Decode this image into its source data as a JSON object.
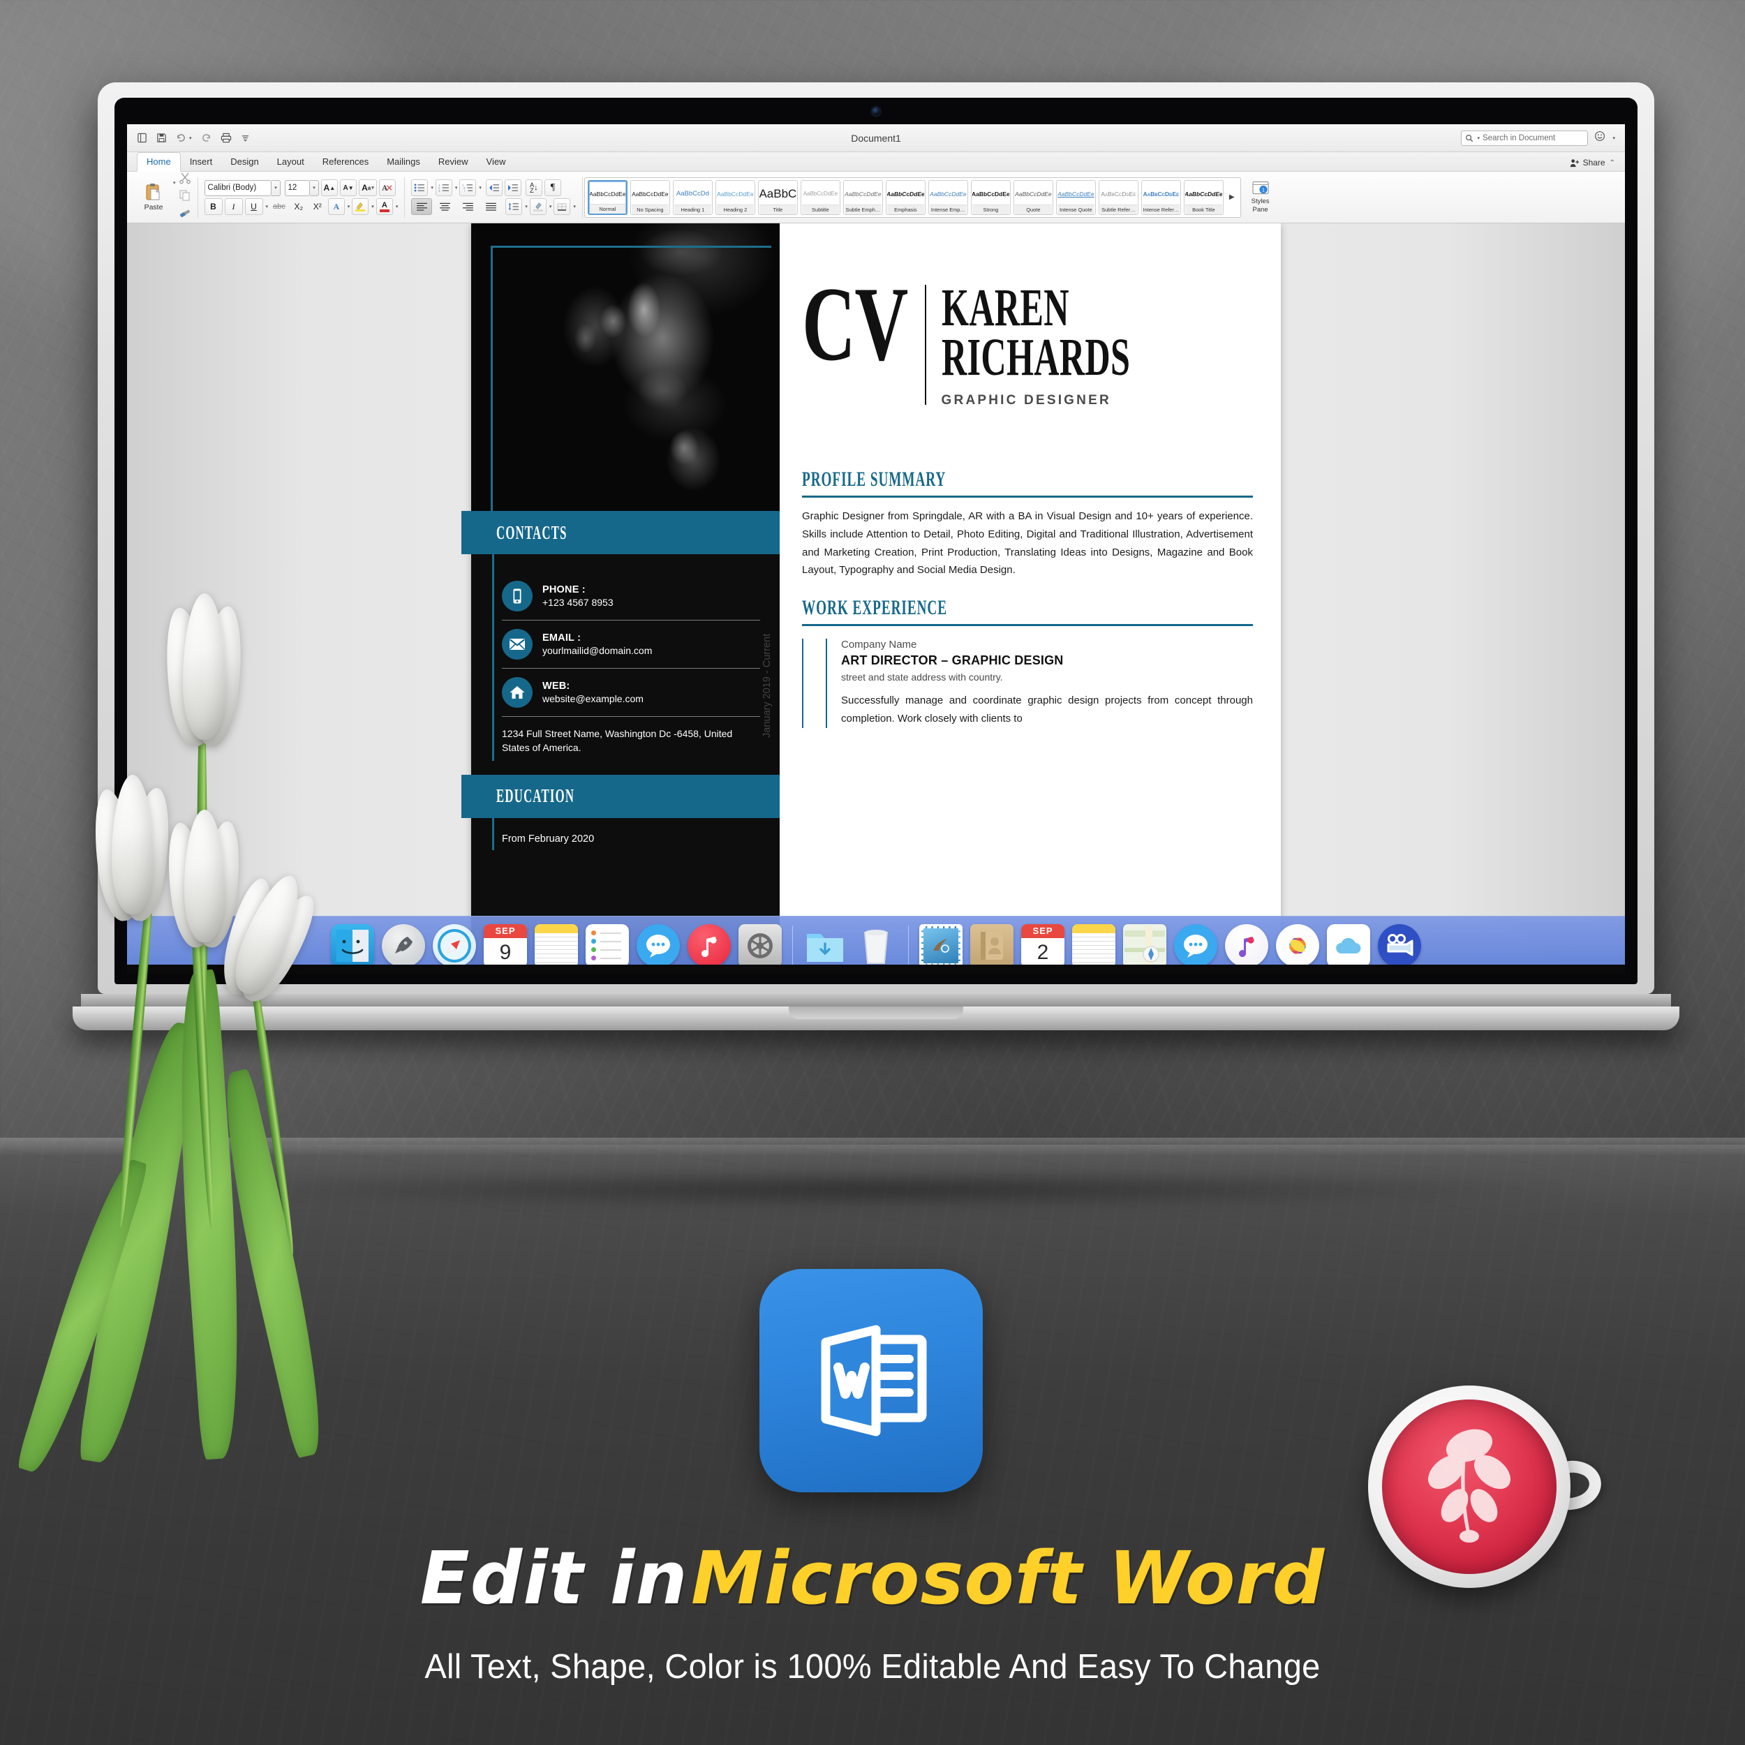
{
  "app": {
    "window_title": "Document1",
    "search_placeholder": "Search in Document",
    "share_label": "Share",
    "quick_access": [
      "new-document-icon",
      "save-icon",
      "undo-icon",
      "redo-icon",
      "print-icon",
      "customize-toolbar-icon"
    ],
    "smiley_icon": "smiley-feedback-icon",
    "collapse_icon": "collapse-ribbon-icon"
  },
  "tabs": [
    {
      "label": "Home",
      "active": true
    },
    {
      "label": "Insert",
      "active": false
    },
    {
      "label": "Design",
      "active": false
    },
    {
      "label": "Layout",
      "active": false
    },
    {
      "label": "References",
      "active": false
    },
    {
      "label": "Mailings",
      "active": false
    },
    {
      "label": "Review",
      "active": false
    },
    {
      "label": "View",
      "active": false
    }
  ],
  "ribbon": {
    "paste_label": "Paste",
    "font_name": "Calibri (Body)",
    "font_size": "12",
    "grow_font": "A▲",
    "shrink_font": "A▼",
    "change_case": "Aa",
    "clear_formatting": "clear-formatting-icon",
    "bold": "B",
    "italic": "I",
    "underline": "U",
    "strikethrough": "abc",
    "subscript": "X₂",
    "superscript": "X²",
    "text_effects": "A",
    "highlight": "highlight-icon",
    "font_color": "A",
    "styles_pane_label": "Styles\nPane",
    "styles_pane_line1": "Styles",
    "styles_pane_line2": "Pane"
  },
  "styles_gallery": [
    {
      "sample": "AaBbCcDdEe",
      "name": "Normal",
      "selected": true
    },
    {
      "sample": "AaBbCcDdEe",
      "name": "No Spacing",
      "selected": false
    },
    {
      "sample": "AaBbCcDd",
      "name": "Heading 1",
      "selected": false
    },
    {
      "sample": "AaBbCcDdEe",
      "name": "Heading 2",
      "selected": false
    },
    {
      "sample": "AaBbC",
      "name": "Title",
      "selected": false
    },
    {
      "sample": "AaBbCcDdEe",
      "name": "Subtitle",
      "selected": false
    },
    {
      "sample": "AaBbCcDdEe",
      "name": "Subtle Emph…",
      "selected": false
    },
    {
      "sample": "AaBbCcDdEe",
      "name": "Emphasis",
      "selected": false
    },
    {
      "sample": "AaBbCcDdEe",
      "name": "Intense Emp…",
      "selected": false
    },
    {
      "sample": "AaBbCcDdEe",
      "name": "Strong",
      "selected": false
    },
    {
      "sample": "AaBbCcDdEe",
      "name": "Quote",
      "selected": false
    },
    {
      "sample": "AaBbCcDdEe",
      "name": "Intense Quote",
      "selected": false
    },
    {
      "sample": "AaBbCcDdEe",
      "name": "Subtle Refer…",
      "selected": false
    },
    {
      "sample": "AaBbCcDdEe",
      "name": "Intense Refer…",
      "selected": false
    },
    {
      "sample": "AaBbCcDdEe",
      "name": "Book Title",
      "selected": false
    }
  ],
  "document": {
    "header": {
      "cv_word": "CV",
      "name_line1": "KAREN",
      "name_line2": "RICHARDS",
      "role": "GRAPHIC DESIGNER"
    },
    "sidebar": {
      "contacts_heading": "CONTACTS",
      "contacts": [
        {
          "icon": "phone-icon",
          "label": "PHONE :",
          "value": "+123 4567 8953"
        },
        {
          "icon": "email-icon",
          "label": "EMAIL :",
          "value": "yourlmailid@domain.com"
        },
        {
          "icon": "home-icon",
          "label": "WEB:",
          "value": "website@example.com"
        }
      ],
      "address": "1234 Full Street Name, Washington Dc -6458, United States of America.",
      "education_heading": "EDUCATION",
      "education_date": "From February 2020"
    },
    "profile": {
      "heading": "PROFILE SUMMARY",
      "text": "Graphic Designer from Springdale, AR with a BA in Visual Design and 10+ years of experience. Skills include Attention to Detail, Photo Editing, Digital and Traditional Illustration, Advertisement and Marketing Creation, Print Production, Translating Ideas into Designs, Magazine and Book Layout, Typography and Social Media Design."
    },
    "work": {
      "heading": "WORK EXPERIENCE",
      "entries": [
        {
          "date": "January 2019 - Current",
          "company": "Company Name",
          "title": "ART DIRECTOR – GRAPHIC DESIGN",
          "address": "street and state address with country.",
          "description": "Successfully manage and coordinate graphic design projects from concept through completion. Work closely with clients to"
        }
      ]
    }
  },
  "dock": [
    {
      "name": "finder-icon",
      "running": true
    },
    {
      "name": "launchpad-icon",
      "running": false
    },
    {
      "name": "safari-icon",
      "running": false
    },
    {
      "name": "calendar-icon",
      "running": false,
      "month": "SEP",
      "day": "9"
    },
    {
      "name": "notes-icon",
      "running": false
    },
    {
      "name": "reminders-icon",
      "running": false
    },
    {
      "name": "messages-icon",
      "running": false
    },
    {
      "name": "itunes-icon",
      "running": false
    },
    {
      "name": "system-preferences-icon",
      "running": false
    },
    {
      "name": "separator",
      "running": false
    },
    {
      "name": "downloads-folder-icon",
      "running": false
    },
    {
      "name": "trash-icon",
      "running": false
    },
    {
      "name": "separator",
      "running": false
    },
    {
      "name": "mail-icon",
      "running": true
    },
    {
      "name": "contacts-icon",
      "running": false
    },
    {
      "name": "calendar-icon-2",
      "running": false,
      "month": "SEP",
      "day": "2"
    },
    {
      "name": "notes-icon-2",
      "running": false
    },
    {
      "name": "maps-icon",
      "running": false
    },
    {
      "name": "messages-icon-2",
      "running": false
    },
    {
      "name": "itunes-icon-2",
      "running": false
    },
    {
      "name": "photos-icon",
      "running": false
    },
    {
      "name": "icloud-icon",
      "running": false
    },
    {
      "name": "imovie-icon",
      "running": true
    }
  ],
  "promo": {
    "headline_white": "Edit in",
    "headline_yellow": "Microsoft Word",
    "subline": "All Text, Shape, Color is 100% Editable And Easy To Change",
    "word_logo": "microsoft-word-logo"
  },
  "colors": {
    "accent_teal": "#16688a",
    "accent_teal_light": "#1d6e8c",
    "sidebar_dark": "#0d0d0d",
    "word_blue": "#2f86dd",
    "promo_yellow": "#ffd02a",
    "tab_active": "#1b6ca8"
  }
}
